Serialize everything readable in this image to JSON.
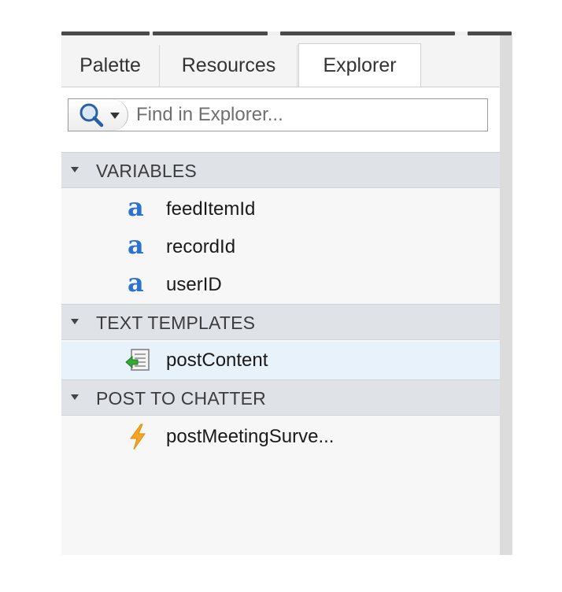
{
  "tabs": [
    {
      "label": "Palette",
      "active": false
    },
    {
      "label": "Resources",
      "active": false
    },
    {
      "label": "Explorer",
      "active": true
    }
  ],
  "search": {
    "placeholder": "Find in Explorer...",
    "value": ""
  },
  "sections": [
    {
      "title": "VARIABLES",
      "items": [
        {
          "label": "feedItemId",
          "icon": "variable-text-icon"
        },
        {
          "label": "recordId",
          "icon": "variable-text-icon"
        },
        {
          "label": "userID",
          "icon": "variable-text-icon"
        }
      ]
    },
    {
      "title": "TEXT TEMPLATES",
      "items": [
        {
          "label": "postContent",
          "icon": "text-template-icon",
          "selected": true
        }
      ]
    },
    {
      "title": "POST TO CHATTER",
      "items": [
        {
          "label": "postMeetingSurve...",
          "icon": "action-lightning-icon"
        }
      ]
    }
  ],
  "colors": {
    "accent": "#2a72d0",
    "section_header_bg": "#dfe3e7",
    "selected_row_bg": "#e8f2fb",
    "lightning": "#f5a623"
  }
}
